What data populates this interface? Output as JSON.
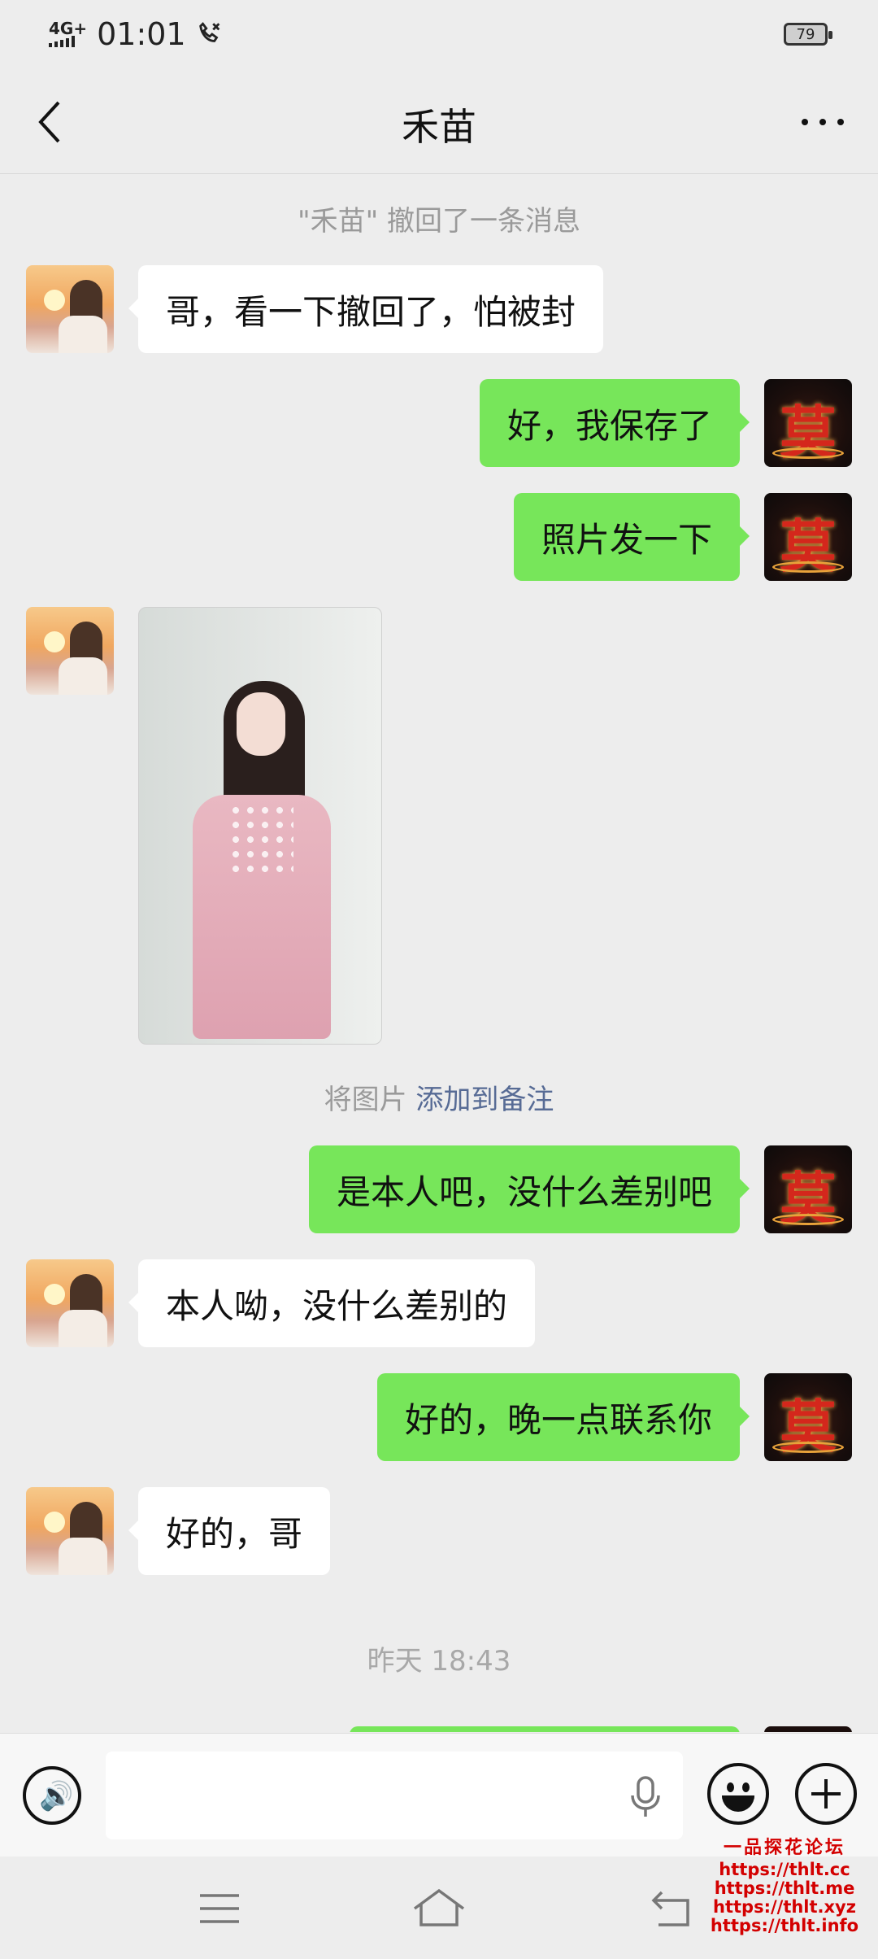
{
  "status_bar": {
    "network": "4G+",
    "time": "01:01",
    "battery": "79"
  },
  "header": {
    "title": "禾苗"
  },
  "messages": {
    "recall_notice": "\"禾苗\" 撤回了一条消息",
    "m1": "哥，看一下撤回了，怕被封",
    "m2": "好，我保存了",
    "m3": "照片发一下",
    "add_note_prefix": "将图片",
    "add_note_link": "添加到备注",
    "m4": "是本人吧，没什么差别吧",
    "m5": "本人呦，没什么差别的",
    "m6": "好的，晚一点联系你",
    "m7": "好的，哥",
    "timestamp": "昨天 18:43"
  },
  "avatar_me_glyph": "莫",
  "watermark": {
    "brand": "一品探花论坛",
    "urls": [
      "https://thlt.cc",
      "https://thlt.me",
      "https://thlt.xyz",
      "https://thlt.info"
    ]
  },
  "colors": {
    "bubble_out": "#77e65a",
    "bubble_in": "#ffffff",
    "background": "#ededed",
    "link": "#576b95"
  }
}
